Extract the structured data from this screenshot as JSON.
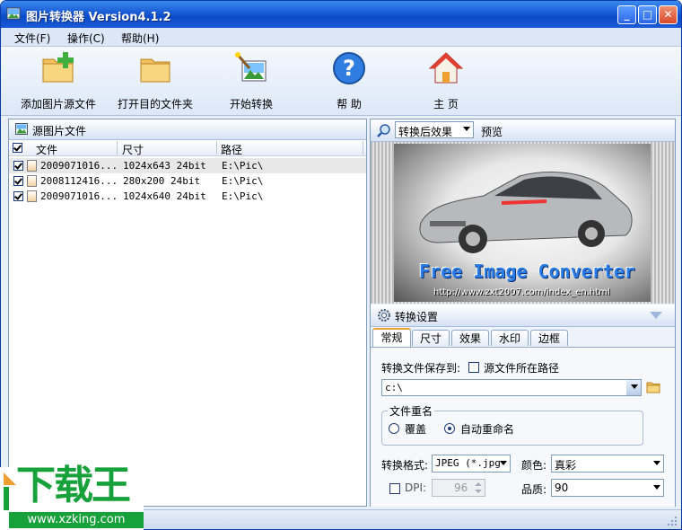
{
  "window": {
    "title": "图片转换器 Version4.1.2",
    "controls": {
      "minimize": "_",
      "maximize": "□",
      "close": "✕"
    }
  },
  "menu": [
    "文件(F)",
    "操作(C)",
    "帮助(H)"
  ],
  "toolbar": {
    "add_label": "添加图片源文件",
    "open_label": "打开目的文件夹",
    "start_label": "开始转换",
    "help_label": "帮 助",
    "home_label": "主 页"
  },
  "source_panel": {
    "title": "源图片文件",
    "columns": [
      "文件",
      "尺寸",
      "路径"
    ],
    "rows": [
      {
        "file": "2009071016...",
        "size": "1024x643  24bit",
        "path": "E:\\Pic\\"
      },
      {
        "file": "2008112416...",
        "size": "280x200  24bit",
        "path": "E:\\Pic\\"
      },
      {
        "file": "2009071016...",
        "size": "1024x640  24bit",
        "path": "E:\\Pic\\"
      }
    ]
  },
  "preview": {
    "mode_selected": "转换后效果",
    "preview_label": "预览",
    "image_title": "Free Image Converter",
    "image_url": "http://www.zxt2007.com/index_en.html"
  },
  "settings": {
    "title": "转换设置",
    "tabs": [
      "常规",
      "尺寸",
      "效果",
      "水印",
      "边框"
    ],
    "save_to_label": "转换文件保存到:",
    "source_path_label": "源文件所在路径",
    "save_path": "c:\\",
    "rename_group": "文件重名",
    "overwrite_label": "覆盖",
    "auto_rename_label": "自动重命名",
    "format_label": "转换格式:",
    "format_value": "JPEG (*.jpg",
    "color_label": "颜色:",
    "color_value": "真彩",
    "dpi_label": "DPI:",
    "dpi_value": "96",
    "quality_label": "品质:",
    "quality_value": "90"
  },
  "watermark": {
    "text": "下载王",
    "url": "www.xzking.com"
  },
  "colors": {
    "title_bar": "#1b5fd7",
    "accent_orange": "#f0a030",
    "watermark_green": "#17a13a"
  }
}
